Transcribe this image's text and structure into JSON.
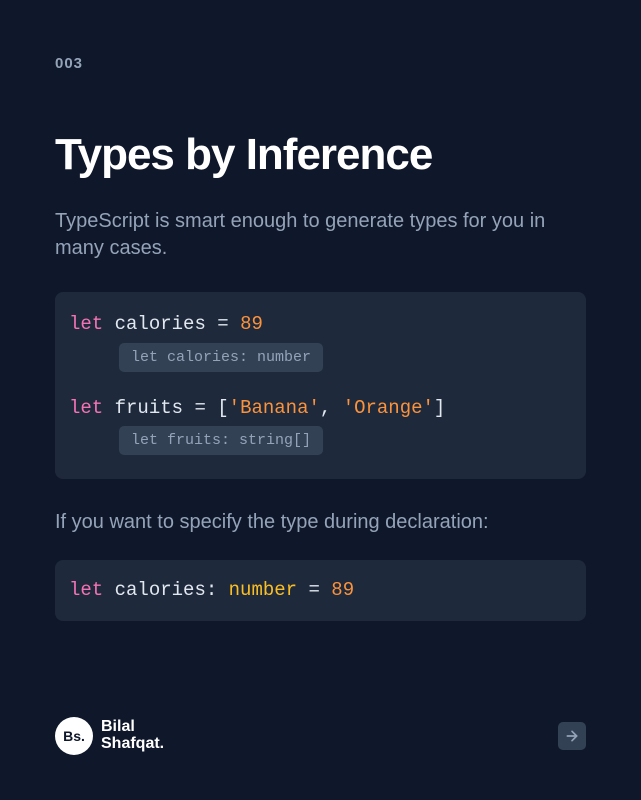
{
  "pageNumber": "003",
  "title": "Types by Inference",
  "intro": "TypeScript is smart enough to generate types for you in many cases.",
  "code1": {
    "let": "let",
    "var1": "calories",
    "eq": "=",
    "val1": "89",
    "hint1": "let calories: number",
    "var2": "fruits",
    "lbracket": "[",
    "str1": "'Banana'",
    "comma": ",",
    "str2": "'Orange'",
    "rbracket": "]",
    "hint2": "let fruits: string[]"
  },
  "subtext": "If you want to specify the type during declaration:",
  "code2": {
    "let": "let",
    "var": "calories",
    "colon": ":",
    "type": "number",
    "eq": "=",
    "val": "89"
  },
  "brand": {
    "badge": "Bs.",
    "line1": "Bilal",
    "line2": "Shafqat"
  }
}
